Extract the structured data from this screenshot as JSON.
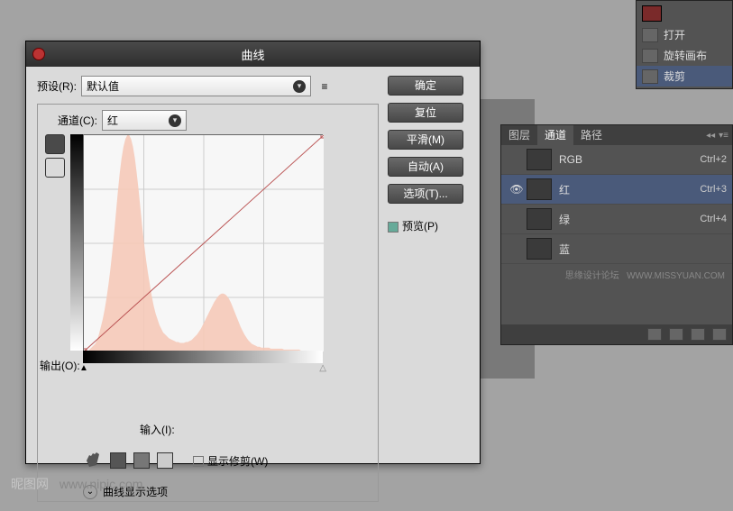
{
  "dialog": {
    "title": "曲线",
    "preset_label": "预设(R):",
    "preset_value": "默认值",
    "channel_label": "通道(C):",
    "channel_value": "红",
    "output_label": "输出(O):",
    "input_label": "输入(I):",
    "show_clip_label": "显示修剪(W)",
    "display_opts_label": "曲线显示选项",
    "buttons": {
      "ok": "确定",
      "reset": "复位",
      "smooth": "平滑(M)",
      "auto": "自动(A)",
      "options": "选项(T)..."
    },
    "preview_label": "预览(P)",
    "preview_checked": true
  },
  "history": {
    "items": [
      {
        "icon": "open-icon",
        "label": "打开"
      },
      {
        "icon": "rotate-icon",
        "label": "旋转画布"
      },
      {
        "icon": "crop-icon",
        "label": "裁剪"
      }
    ]
  },
  "channels_panel": {
    "tabs": [
      "图层",
      "通道",
      "路径"
    ],
    "active_tab": 1,
    "rows": [
      {
        "visible": false,
        "name": "RGB",
        "shortcut": "Ctrl+2",
        "selected": false
      },
      {
        "visible": true,
        "name": "红",
        "shortcut": "Ctrl+3",
        "selected": true
      },
      {
        "visible": false,
        "name": "绿",
        "shortcut": "Ctrl+4",
        "selected": false
      },
      {
        "visible": false,
        "name": "蓝",
        "shortcut": "",
        "selected": false
      }
    ],
    "brand_text": "思缘设计论坛",
    "brand_url": "WWW.MISSYUAN.COM"
  },
  "watermark": {
    "site": "昵图网",
    "url": "www.nipic.com"
  },
  "chart_data": {
    "type": "line",
    "title": "",
    "xlabel": "输入",
    "ylabel": "输出",
    "xlim": [
      0,
      255
    ],
    "ylim": [
      0,
      255
    ],
    "series": [
      {
        "name": "curve",
        "x": [
          0,
          255
        ],
        "y": [
          0,
          255
        ]
      }
    ],
    "histogram": [
      0,
      0,
      0,
      2,
      4,
      6,
      8,
      12,
      18,
      26,
      34,
      44,
      56,
      70,
      86,
      104,
      124,
      146,
      168,
      188,
      204,
      216,
      224,
      228,
      228,
      224,
      216,
      204,
      188,
      170,
      150,
      130,
      112,
      96,
      82,
      70,
      58,
      48,
      40,
      34,
      28,
      24,
      20,
      18,
      16,
      14,
      13,
      12,
      11,
      10,
      10,
      9,
      9,
      9,
      10,
      10,
      11,
      12,
      14,
      16,
      18,
      21,
      24,
      28,
      32,
      36,
      40,
      44,
      48,
      52,
      55,
      58,
      60,
      61,
      61,
      60,
      58,
      55,
      51,
      46,
      41,
      36,
      31,
      26,
      22,
      18,
      15,
      12,
      10,
      8,
      7,
      6,
      5,
      5,
      4,
      4,
      4,
      4,
      4,
      3,
      3,
      3,
      3,
      3,
      3,
      3,
      2,
      2,
      2,
      2,
      2,
      2,
      2,
      2,
      2,
      1,
      1,
      1,
      1,
      1,
      1,
      1,
      1,
      1,
      1,
      0,
      0,
      0
    ]
  }
}
